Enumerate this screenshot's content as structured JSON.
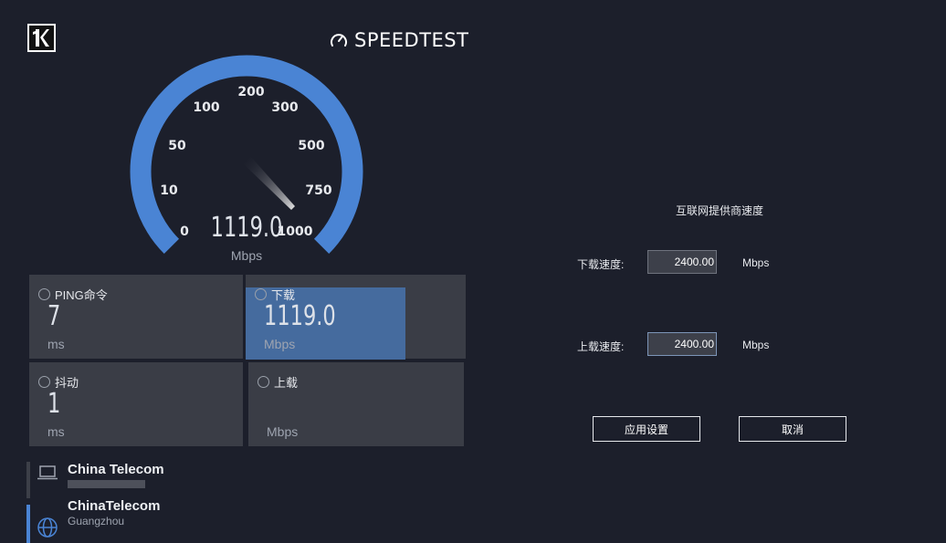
{
  "brand": {
    "name": "SPEEDTEST",
    "icon": "speedometer-icon"
  },
  "gauge": {
    "value": "1119.0",
    "unit": "Mbps",
    "ticks": [
      "0",
      "10",
      "50",
      "100",
      "200",
      "300",
      "500",
      "750",
      "1000"
    ],
    "accent": "#4a84d4"
  },
  "tiles": {
    "ping": {
      "label": "PING命令",
      "value": "7",
      "unit": "ms",
      "icon": "ping-icon"
    },
    "download": {
      "label": "下载",
      "value": "1119.0",
      "unit": "Mbps",
      "icon": "download-arrow-icon"
    },
    "jitter": {
      "label": "抖动",
      "value": "1",
      "unit": "ms",
      "icon": "jitter-icon"
    },
    "upload": {
      "label": "上载",
      "value": "",
      "unit": "Mbps",
      "icon": "upload-arrow-icon"
    }
  },
  "servers": [
    {
      "name": "China Telecom",
      "sub": "",
      "icon": "laptop-icon"
    },
    {
      "name": "ChinaTelecom",
      "sub": "Guangzhou",
      "icon": "globe-icon"
    }
  ],
  "isp_settings": {
    "title": "互联网提供商速度",
    "download_label": "下载速度:",
    "download_value": "2400.00",
    "download_unit": "Mbps",
    "upload_label": "上载速度:",
    "upload_value": "2400.00",
    "upload_unit": "Mbps",
    "apply_label": "应用设置",
    "cancel_label": "取消"
  }
}
